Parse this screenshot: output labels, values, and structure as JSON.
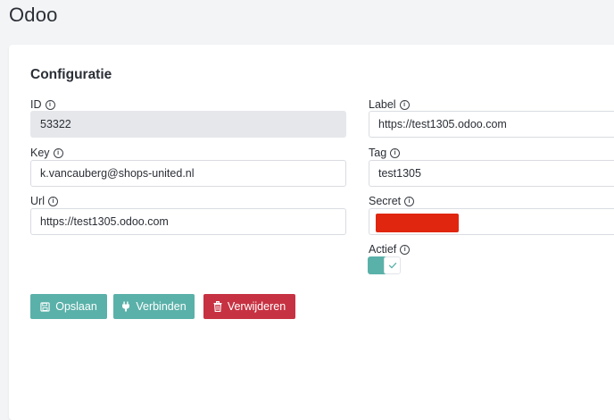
{
  "app": {
    "title": "Odoo"
  },
  "card": {
    "title": "Configuratie"
  },
  "fields": {
    "id": {
      "label": "ID",
      "value": "53322"
    },
    "key": {
      "label": "Key",
      "value": "k.vancauberg@shops-united.nl"
    },
    "url": {
      "label": "Url",
      "value": "https://test1305.odoo.com"
    },
    "label": {
      "label": "Label",
      "value": "https://test1305.odoo.com"
    },
    "tag": {
      "label": "Tag",
      "value": "test1305"
    },
    "secret": {
      "label": "Secret",
      "value": ""
    },
    "actief": {
      "label": "Actief",
      "checked": true
    }
  },
  "buttons": {
    "save": "Opslaan",
    "connect": "Verbinden",
    "delete": "Verwijderen"
  },
  "colors": {
    "accent": "#5ab1a9",
    "danger": "#c73242",
    "redaction": "#e0260f"
  },
  "icons": {
    "info": "info-circle-icon",
    "save": "floppy-disk-icon",
    "connect": "plug-icon",
    "delete": "trash-icon",
    "check": "check-icon"
  }
}
